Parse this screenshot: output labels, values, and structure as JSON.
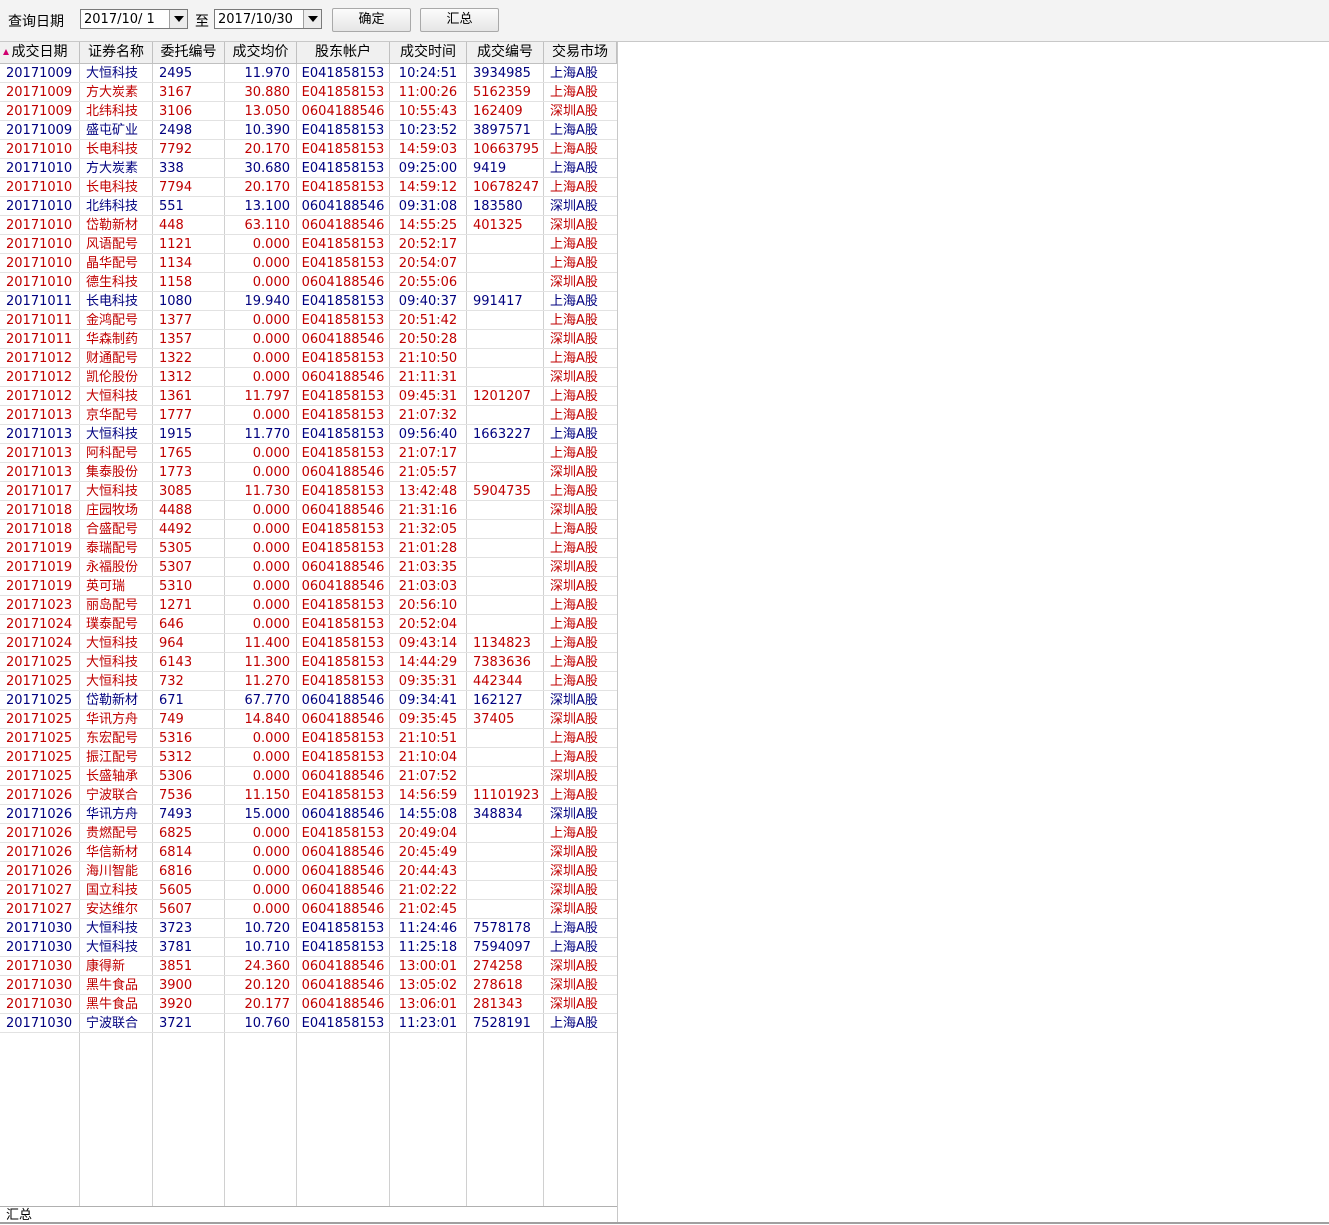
{
  "toolbar": {
    "query_label": "查询日期",
    "start_date": "2017/10/ 1",
    "to_label": "至",
    "end_date": "2017/10/30",
    "confirm_label": "确定",
    "summary_label": "汇总"
  },
  "table": {
    "sort_indicator": "sort-asc-icon",
    "columns": [
      "成交日期",
      "证券名称",
      "委托编号",
      "成交均价",
      "股东帐户",
      "成交时间",
      "成交编号",
      "交易市场"
    ],
    "rows": [
      {
        "date": "20171009",
        "name": "大恒科技",
        "order": "2495",
        "price": "11.970",
        "account": "E041858153",
        "time": "10:24:51",
        "deal": "3934985",
        "market": "上海A股",
        "color": "blue"
      },
      {
        "date": "20171009",
        "name": "方大炭素",
        "order": "3167",
        "price": "30.880",
        "account": "E041858153",
        "time": "11:00:26",
        "deal": "5162359",
        "market": "上海A股",
        "color": "red"
      },
      {
        "date": "20171009",
        "name": "北纬科技",
        "order": "3106",
        "price": "13.050",
        "account": "0604188546",
        "time": "10:55:43",
        "deal": "162409",
        "market": "深圳A股",
        "color": "red"
      },
      {
        "date": "20171009",
        "name": "盛屯矿业",
        "order": "2498",
        "price": "10.390",
        "account": "E041858153",
        "time": "10:23:52",
        "deal": "3897571",
        "market": "上海A股",
        "color": "blue"
      },
      {
        "date": "20171010",
        "name": "长电科技",
        "order": "7792",
        "price": "20.170",
        "account": "E041858153",
        "time": "14:59:03",
        "deal": "10663795",
        "market": "上海A股",
        "color": "red"
      },
      {
        "date": "20171010",
        "name": "方大炭素",
        "order": "338",
        "price": "30.680",
        "account": "E041858153",
        "time": "09:25:00",
        "deal": "9419",
        "market": "上海A股",
        "color": "blue"
      },
      {
        "date": "20171010",
        "name": "长电科技",
        "order": "7794",
        "price": "20.170",
        "account": "E041858153",
        "time": "14:59:12",
        "deal": "10678247",
        "market": "上海A股",
        "color": "red"
      },
      {
        "date": "20171010",
        "name": "北纬科技",
        "order": "551",
        "price": "13.100",
        "account": "0604188546",
        "time": "09:31:08",
        "deal": "183580",
        "market": "深圳A股",
        "color": "blue"
      },
      {
        "date": "20171010",
        "name": "岱勒新材",
        "order": "448",
        "price": "63.110",
        "account": "0604188546",
        "time": "14:55:25",
        "deal": "401325",
        "market": "深圳A股",
        "color": "red"
      },
      {
        "date": "20171010",
        "name": "风语配号",
        "order": "1121",
        "price": "0.000",
        "account": "E041858153",
        "time": "20:52:17",
        "deal": "",
        "market": "上海A股",
        "color": "red"
      },
      {
        "date": "20171010",
        "name": "晶华配号",
        "order": "1134",
        "price": "0.000",
        "account": "E041858153",
        "time": "20:54:07",
        "deal": "",
        "market": "上海A股",
        "color": "red"
      },
      {
        "date": "20171010",
        "name": "德生科技",
        "order": "1158",
        "price": "0.000",
        "account": "0604188546",
        "time": "20:55:06",
        "deal": "",
        "market": "深圳A股",
        "color": "red"
      },
      {
        "date": "20171011",
        "name": "长电科技",
        "order": "1080",
        "price": "19.940",
        "account": "E041858153",
        "time": "09:40:37",
        "deal": "991417",
        "market": "上海A股",
        "color": "blue"
      },
      {
        "date": "20171011",
        "name": "金鸿配号",
        "order": "1377",
        "price": "0.000",
        "account": "E041858153",
        "time": "20:51:42",
        "deal": "",
        "market": "上海A股",
        "color": "red"
      },
      {
        "date": "20171011",
        "name": "华森制药",
        "order": "1357",
        "price": "0.000",
        "account": "0604188546",
        "time": "20:50:28",
        "deal": "",
        "market": "深圳A股",
        "color": "red"
      },
      {
        "date": "20171012",
        "name": "财通配号",
        "order": "1322",
        "price": "0.000",
        "account": "E041858153",
        "time": "21:10:50",
        "deal": "",
        "market": "上海A股",
        "color": "red"
      },
      {
        "date": "20171012",
        "name": "凯伦股份",
        "order": "1312",
        "price": "0.000",
        "account": "0604188546",
        "time": "21:11:31",
        "deal": "",
        "market": "深圳A股",
        "color": "red"
      },
      {
        "date": "20171012",
        "name": "大恒科技",
        "order": "1361",
        "price": "11.797",
        "account": "E041858153",
        "time": "09:45:31",
        "deal": "1201207",
        "market": "上海A股",
        "color": "red"
      },
      {
        "date": "20171013",
        "name": "京华配号",
        "order": "1777",
        "price": "0.000",
        "account": "E041858153",
        "time": "21:07:32",
        "deal": "",
        "market": "上海A股",
        "color": "red"
      },
      {
        "date": "20171013",
        "name": "大恒科技",
        "order": "1915",
        "price": "11.770",
        "account": "E041858153",
        "time": "09:56:40",
        "deal": "1663227",
        "market": "上海A股",
        "color": "blue"
      },
      {
        "date": "20171013",
        "name": "阿科配号",
        "order": "1765",
        "price": "0.000",
        "account": "E041858153",
        "time": "21:07:17",
        "deal": "",
        "market": "上海A股",
        "color": "red"
      },
      {
        "date": "20171013",
        "name": "集泰股份",
        "order": "1773",
        "price": "0.000",
        "account": "0604188546",
        "time": "21:05:57",
        "deal": "",
        "market": "深圳A股",
        "color": "red"
      },
      {
        "date": "20171017",
        "name": "大恒科技",
        "order": "3085",
        "price": "11.730",
        "account": "E041858153",
        "time": "13:42:48",
        "deal": "5904735",
        "market": "上海A股",
        "color": "red"
      },
      {
        "date": "20171018",
        "name": "庄园牧场",
        "order": "4488",
        "price": "0.000",
        "account": "0604188546",
        "time": "21:31:16",
        "deal": "",
        "market": "深圳A股",
        "color": "red"
      },
      {
        "date": "20171018",
        "name": "合盛配号",
        "order": "4492",
        "price": "0.000",
        "account": "E041858153",
        "time": "21:32:05",
        "deal": "",
        "market": "上海A股",
        "color": "red"
      },
      {
        "date": "20171019",
        "name": "泰瑞配号",
        "order": "5305",
        "price": "0.000",
        "account": "E041858153",
        "time": "21:01:28",
        "deal": "",
        "market": "上海A股",
        "color": "red"
      },
      {
        "date": "20171019",
        "name": "永福股份",
        "order": "5307",
        "price": "0.000",
        "account": "0604188546",
        "time": "21:03:35",
        "deal": "",
        "market": "深圳A股",
        "color": "red"
      },
      {
        "date": "20171019",
        "name": "英可瑞",
        "order": "5310",
        "price": "0.000",
        "account": "0604188546",
        "time": "21:03:03",
        "deal": "",
        "market": "深圳A股",
        "color": "red"
      },
      {
        "date": "20171023",
        "name": "丽岛配号",
        "order": "1271",
        "price": "0.000",
        "account": "E041858153",
        "time": "20:56:10",
        "deal": "",
        "market": "上海A股",
        "color": "red"
      },
      {
        "date": "20171024",
        "name": "璞泰配号",
        "order": "646",
        "price": "0.000",
        "account": "E041858153",
        "time": "20:52:04",
        "deal": "",
        "market": "上海A股",
        "color": "red"
      },
      {
        "date": "20171024",
        "name": "大恒科技",
        "order": "964",
        "price": "11.400",
        "account": "E041858153",
        "time": "09:43:14",
        "deal": "1134823",
        "market": "上海A股",
        "color": "red"
      },
      {
        "date": "20171025",
        "name": "大恒科技",
        "order": "6143",
        "price": "11.300",
        "account": "E041858153",
        "time": "14:44:29",
        "deal": "7383636",
        "market": "上海A股",
        "color": "red"
      },
      {
        "date": "20171025",
        "name": "大恒科技",
        "order": "732",
        "price": "11.270",
        "account": "E041858153",
        "time": "09:35:31",
        "deal": "442344",
        "market": "上海A股",
        "color": "red"
      },
      {
        "date": "20171025",
        "name": "岱勒新材",
        "order": "671",
        "price": "67.770",
        "account": "0604188546",
        "time": "09:34:41",
        "deal": "162127",
        "market": "深圳A股",
        "color": "blue"
      },
      {
        "date": "20171025",
        "name": "华讯方舟",
        "order": "749",
        "price": "14.840",
        "account": "0604188546",
        "time": "09:35:45",
        "deal": "37405",
        "market": "深圳A股",
        "color": "red"
      },
      {
        "date": "20171025",
        "name": "东宏配号",
        "order": "5316",
        "price": "0.000",
        "account": "E041858153",
        "time": "21:10:51",
        "deal": "",
        "market": "上海A股",
        "color": "red"
      },
      {
        "date": "20171025",
        "name": "振江配号",
        "order": "5312",
        "price": "0.000",
        "account": "E041858153",
        "time": "21:10:04",
        "deal": "",
        "market": "上海A股",
        "color": "red"
      },
      {
        "date": "20171025",
        "name": "长盛轴承",
        "order": "5306",
        "price": "0.000",
        "account": "0604188546",
        "time": "21:07:52",
        "deal": "",
        "market": "深圳A股",
        "color": "red"
      },
      {
        "date": "20171026",
        "name": "宁波联合",
        "order": "7536",
        "price": "11.150",
        "account": "E041858153",
        "time": "14:56:59",
        "deal": "11101923",
        "market": "上海A股",
        "color": "red"
      },
      {
        "date": "20171026",
        "name": "华讯方舟",
        "order": "7493",
        "price": "15.000",
        "account": "0604188546",
        "time": "14:55:08",
        "deal": "348834",
        "market": "深圳A股",
        "color": "blue"
      },
      {
        "date": "20171026",
        "name": "贵燃配号",
        "order": "6825",
        "price": "0.000",
        "account": "E041858153",
        "time": "20:49:04",
        "deal": "",
        "market": "上海A股",
        "color": "red"
      },
      {
        "date": "20171026",
        "name": "华信新材",
        "order": "6814",
        "price": "0.000",
        "account": "0604188546",
        "time": "20:45:49",
        "deal": "",
        "market": "深圳A股",
        "color": "red"
      },
      {
        "date": "20171026",
        "name": "海川智能",
        "order": "6816",
        "price": "0.000",
        "account": "0604188546",
        "time": "20:44:43",
        "deal": "",
        "market": "深圳A股",
        "color": "red"
      },
      {
        "date": "20171027",
        "name": "国立科技",
        "order": "5605",
        "price": "0.000",
        "account": "0604188546",
        "time": "21:02:22",
        "deal": "",
        "market": "深圳A股",
        "color": "red"
      },
      {
        "date": "20171027",
        "name": "安达维尔",
        "order": "5607",
        "price": "0.000",
        "account": "0604188546",
        "time": "21:02:45",
        "deal": "",
        "market": "深圳A股",
        "color": "red"
      },
      {
        "date": "20171030",
        "name": "大恒科技",
        "order": "3723",
        "price": "10.720",
        "account": "E041858153",
        "time": "11:24:46",
        "deal": "7578178",
        "market": "上海A股",
        "color": "blue"
      },
      {
        "date": "20171030",
        "name": "大恒科技",
        "order": "3781",
        "price": "10.710",
        "account": "E041858153",
        "time": "11:25:18",
        "deal": "7594097",
        "market": "上海A股",
        "color": "blue"
      },
      {
        "date": "20171030",
        "name": "康得新",
        "order": "3851",
        "price": "24.360",
        "account": "0604188546",
        "time": "13:00:01",
        "deal": "274258",
        "market": "深圳A股",
        "color": "red"
      },
      {
        "date": "20171030",
        "name": "黑牛食品",
        "order": "3900",
        "price": "20.120",
        "account": "0604188546",
        "time": "13:05:02",
        "deal": "278618",
        "market": "深圳A股",
        "color": "red"
      },
      {
        "date": "20171030",
        "name": "黑牛食品",
        "order": "3920",
        "price": "20.177",
        "account": "0604188546",
        "time": "13:06:01",
        "deal": "281343",
        "market": "深圳A股",
        "color": "red"
      },
      {
        "date": "20171030",
        "name": "宁波联合",
        "order": "3721",
        "price": "10.760",
        "account": "E041858153",
        "time": "11:23:01",
        "deal": "7528191",
        "market": "上海A股",
        "color": "blue"
      }
    ],
    "summary_row_label": "汇总"
  },
  "colors": {
    "buy": "#c00000",
    "sell": "#00007f",
    "sort_indicator": "#d0006f"
  }
}
